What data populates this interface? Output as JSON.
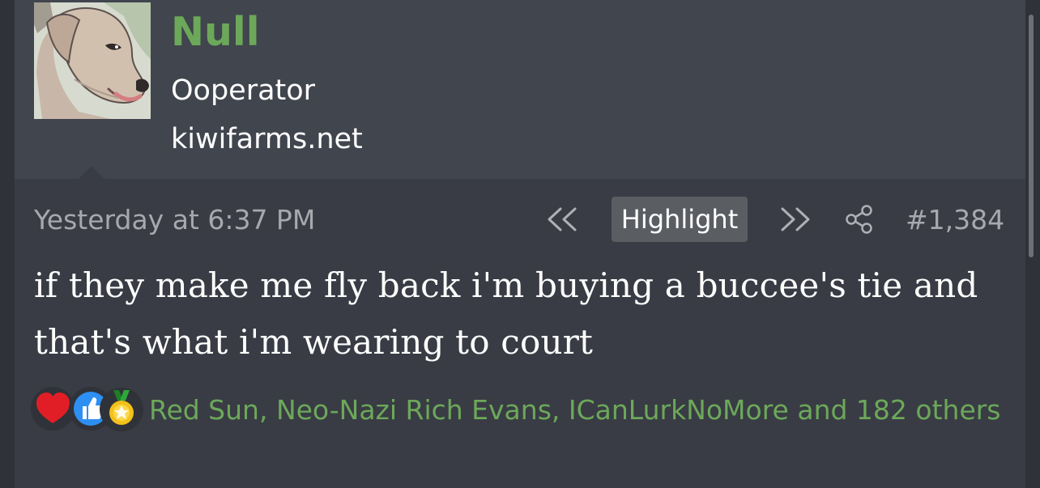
{
  "user": {
    "name": "Null",
    "title": "Ooperator",
    "site": "kiwifarms.net"
  },
  "post": {
    "date": "Yesterday at 6:37 PM",
    "highlight_label": "Highlight",
    "number": "#1,384",
    "body": "if they make me fly back i'm buying a buccee's tie and that's what i'm wearing to court"
  },
  "reactions": {
    "icons": [
      "heart-icon",
      "thumbs-up-icon",
      "medal-icon"
    ],
    "text": "Red Sun, Neo-Nazi Rich Evans, ICanLurkNoMore and 182 others"
  },
  "colors": {
    "background": "#393c44",
    "user_block": "#41454d",
    "username": "#6ca85a",
    "muted_text": "#a6a9ad",
    "button": "#5a5d62"
  }
}
